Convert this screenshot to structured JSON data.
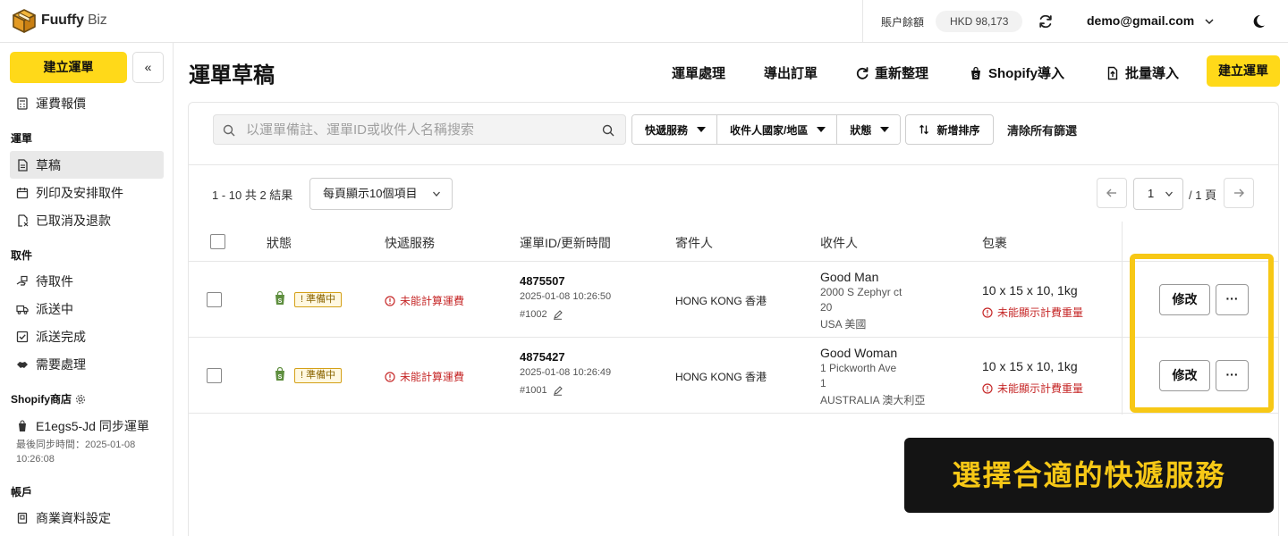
{
  "app": {
    "logo_name": "Fuuffy",
    "logo_suffix": "Biz"
  },
  "topbar": {
    "balance_label": "賬户餘額",
    "balance_value": "HKD 98,173",
    "account_email": "demo@gmail.com"
  },
  "sidebar": {
    "create_label": "建立運單",
    "collapse_label": "«",
    "quote_label": "運費報價",
    "sections": {
      "waybill": "運單",
      "pickup": "取件",
      "shopify": "Shopify商店",
      "account": "帳戶"
    },
    "waybill_items": [
      "草稿",
      "列印及安排取件",
      "已取消及退款"
    ],
    "pickup_items": [
      "待取件",
      "派送中",
      "派送完成",
      "需要處理"
    ],
    "shop_item": "E1egs5-Jd 同步運單",
    "shop_sync_line1": "最後同步時間：2025-01-08",
    "shop_sync_line2": "10:26:08",
    "account_items": [
      "商業資料設定"
    ]
  },
  "page": {
    "title": "運單草稿",
    "actions": {
      "process": "運單處理",
      "export": "導出訂單",
      "refresh": "重新整理",
      "shopify_import": "Shopify導入",
      "bulk_import": "批量導入",
      "create": "建立運單"
    }
  },
  "filters": {
    "search_placeholder": "以運單備註、運單ID或收件人名稱搜索",
    "courier": "快遞服務",
    "country": "收件人國家/地區",
    "status": "狀態",
    "sort": "新增排序",
    "clear": "清除所有篩選"
  },
  "pagination": {
    "results": "1 - 10 共 2 結果",
    "per_page": "每頁顯示10個項目",
    "current_page": "1",
    "total_pages": "/ 1 頁"
  },
  "table": {
    "headers": {
      "status": "狀態",
      "courier": "快遞服務",
      "order": "運單ID/更新時間",
      "sender": "寄件人",
      "receiver": "收件人",
      "package": "包裹"
    },
    "rows": [
      {
        "status": "! 準備中",
        "courier": "未能計算運費",
        "order_id": "4875507",
        "updated": "2025-01-08 10:26:50",
        "ref": "#1002",
        "sender": "HONG KONG 香港",
        "receiver_name": "Good Man",
        "receiver_line1": "2000 S Zephyr ct",
        "receiver_line2": "20",
        "receiver_line3": "USA 美國",
        "package_size": "10 x 15 x 10, 1kg",
        "package_note": "未能顯示計費重量",
        "edit_label": "修改",
        "more_label": "···"
      },
      {
        "status": "! 準備中",
        "courier": "未能計算運費",
        "order_id": "4875427",
        "updated": "2025-01-08 10:26:49",
        "ref": "#1001",
        "sender": "HONG KONG 香港",
        "receiver_name": "Good Woman",
        "receiver_line1": "1 Pickworth Ave",
        "receiver_line2": "1",
        "receiver_line3": "AUSTRALIA 澳大利亞",
        "package_size": "10 x 15 x 10, 1kg",
        "package_note": "未能顯示計費重量",
        "edit_label": "修改",
        "more_label": "···"
      }
    ]
  },
  "tip": {
    "text": "選擇合適的快遞服務"
  },
  "colors": {
    "accent": "#ffd919",
    "highlight": "#f7c816",
    "error": "#c62828",
    "shopify": "#5e8e3e"
  }
}
